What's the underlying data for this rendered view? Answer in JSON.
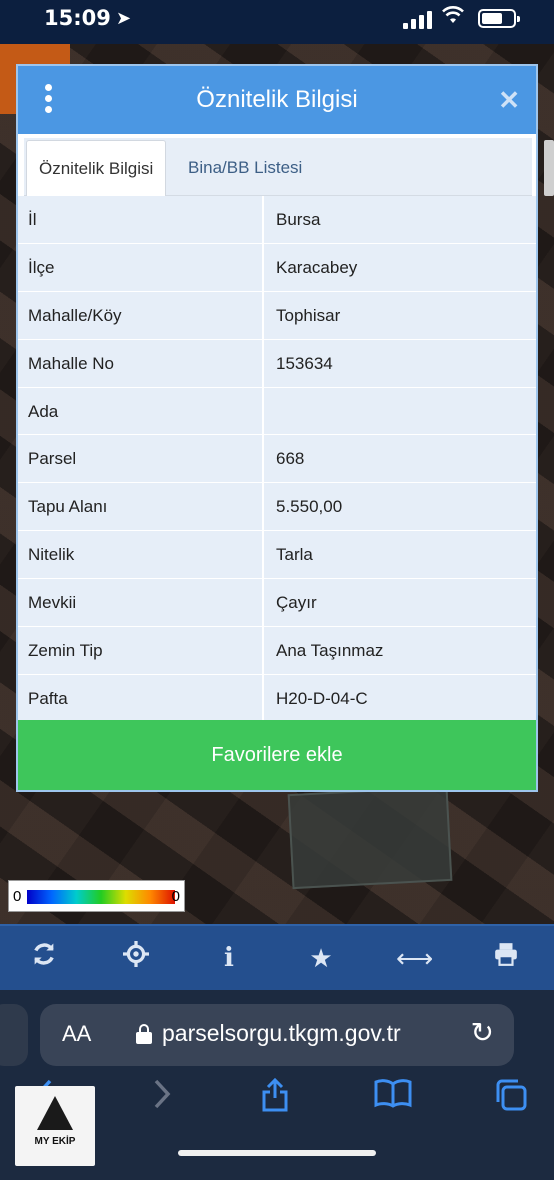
{
  "status_bar": {
    "time": "15:09"
  },
  "dialog": {
    "title": "Öznitelik Bilgisi",
    "tabs": [
      {
        "label": "Öznitelik Bilgisi"
      },
      {
        "label": "Bina/BB Listesi"
      }
    ],
    "rows": [
      {
        "key": "İl",
        "value": "Bursa"
      },
      {
        "key": "İlçe",
        "value": "Karacabey"
      },
      {
        "key": "Mahalle/Köy",
        "value": "Tophisar"
      },
      {
        "key": "Mahalle No",
        "value": "153634"
      },
      {
        "key": "Ada",
        "value": ""
      },
      {
        "key": "Parsel",
        "value": "668"
      },
      {
        "key": "Tapu Alanı",
        "value": "5.550,00"
      },
      {
        "key": "Nitelik",
        "value": "Tarla"
      },
      {
        "key": "Mevkii",
        "value": "Çayır"
      },
      {
        "key": "Zemin Tip",
        "value": "Ana Taşınmaz"
      },
      {
        "key": "Pafta",
        "value": "H20-D-04-C"
      }
    ],
    "favorite_button": "Favorilere ekle"
  },
  "legend": {
    "min": "0",
    "max": "0"
  },
  "map_toolbar": {
    "icons": [
      "refresh-icon",
      "locate-icon",
      "info-icon",
      "star-icon",
      "measure-icon",
      "print-icon"
    ]
  },
  "browser": {
    "aa_label": "AA",
    "url": "parselsorgu.tkgm.gov.tr"
  },
  "logo": {
    "text": "MY EKİP"
  },
  "colors": {
    "header_blue": "#4b97e3",
    "favorite_green": "#3ec65b",
    "toolbar_blue": "#244f8e",
    "row_bg": "#e6eef8"
  }
}
